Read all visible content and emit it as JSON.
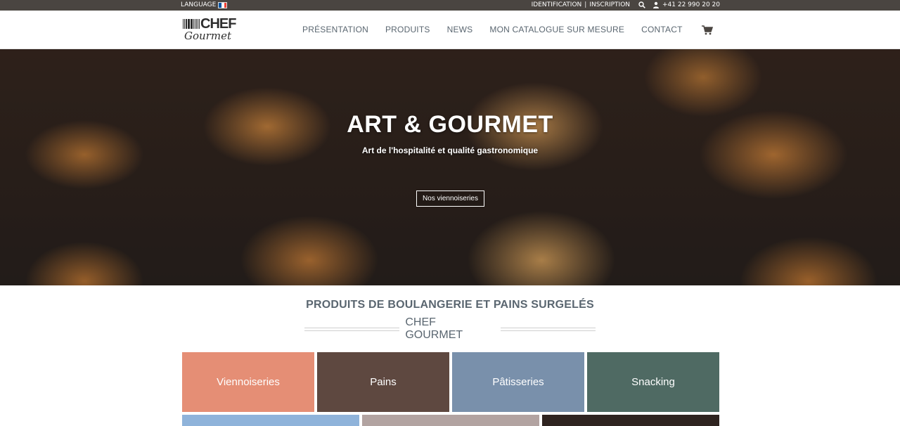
{
  "topbar": {
    "language_label": "LANGUAGE",
    "identification_label": "IDENTIFICATION",
    "separator": "|",
    "inscription_label": "INSCRIPTION",
    "phone": "+41 22 990 20 20",
    "flag_colors": [
      "#0055a4",
      "#ffffff",
      "#ef4135"
    ]
  },
  "logo": {
    "line1": "CHEF",
    "line2": "Gourmet"
  },
  "nav": {
    "items": [
      {
        "label": "PRÉSENTATION"
      },
      {
        "label": "PRODUITS"
      },
      {
        "label": "NEWS"
      },
      {
        "label": "MON CATALOGUE SUR MESURE"
      },
      {
        "label": "CONTACT"
      }
    ]
  },
  "hero": {
    "title": "ART & GOURMET",
    "subtitle": "Art de l'hospitalité et qualité gastronomique",
    "button_label": "Nos viennoiseries"
  },
  "section": {
    "title": "PRODUITS DE BOULANGERIE ET PAINS SURGELÉS",
    "subtitle": "CHEF GOURMET"
  },
  "categories": [
    {
      "label": "Viennoiseries",
      "color": "#e58e75"
    },
    {
      "label": "Pains",
      "color": "#5e4840"
    },
    {
      "label": "Pâtisseries",
      "color": "#7990ab"
    },
    {
      "label": "Snacking",
      "color": "#4f6a63"
    }
  ],
  "categories_row2": [
    {
      "color": "#8fb3da"
    },
    {
      "color": "#b2a3a1"
    },
    {
      "color": "#2f2420"
    }
  ]
}
